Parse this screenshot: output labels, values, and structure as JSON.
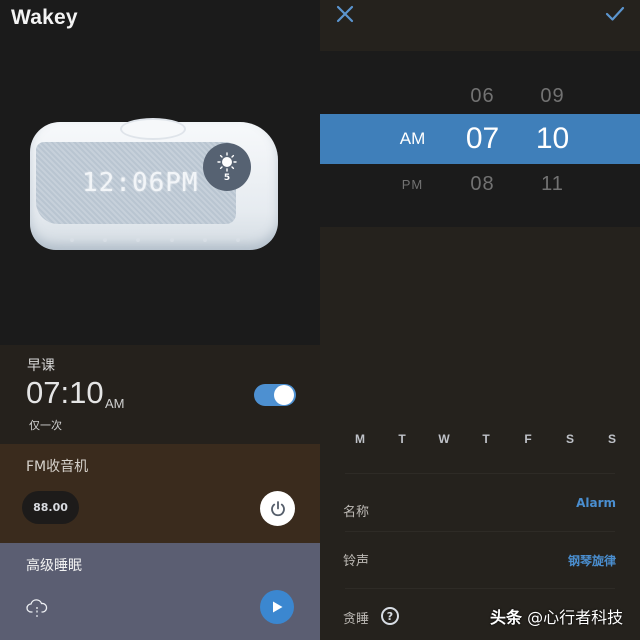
{
  "app": {
    "title": "Wakey"
  },
  "device": {
    "display_time": "12:06PM",
    "brightness_icon": "sun-icon",
    "brightness_level": "5"
  },
  "alarm": {
    "name": "早课",
    "time": "07:10",
    "period": "AM",
    "repeat": "仅一次",
    "enabled": true,
    "toggle_color": "#4d90d1"
  },
  "fm": {
    "title": "FM收音机",
    "frequency": "88.00",
    "power_icon": "power-icon"
  },
  "sleep": {
    "title": "高级睡眠",
    "cloud_icon": "cloud-download-icon",
    "play_icon": "play-icon",
    "play_color": "#3b87d0"
  },
  "editor": {
    "close_icon": "close-icon",
    "confirm_icon": "check-icon",
    "accent": "#3f7fba",
    "picker": {
      "prev": {
        "period": "",
        "hour": "06",
        "minute": "09"
      },
      "selected": {
        "period": "AM",
        "hour": "07",
        "minute": "10"
      },
      "next": {
        "period": "PM",
        "hour": "08",
        "minute": "11"
      }
    },
    "weekdays": [
      "M",
      "T",
      "W",
      "T",
      "F",
      "S",
      "S"
    ],
    "settings": [
      {
        "label": "名称",
        "value": "Alarm"
      },
      {
        "label": "铃声",
        "value": "钢琴旋律"
      },
      {
        "label": "贪睡",
        "help_icon": "help-icon",
        "help_glyph": "?"
      }
    ]
  },
  "watermark": {
    "brand": "头条",
    "handle": "@心行者科技"
  }
}
